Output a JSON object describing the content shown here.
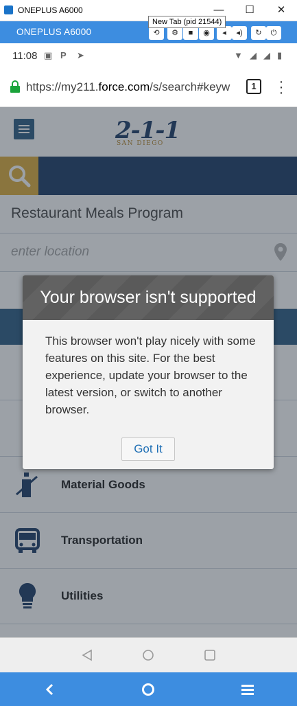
{
  "window": {
    "title": "ONEPLUS A6000",
    "tooltip": "New Tab (pid 21544)",
    "controls": [
      "—",
      "☐",
      "✕"
    ]
  },
  "device_bar": {
    "name": "ONEPLUS A6000"
  },
  "status_bar": {
    "time": "11:08"
  },
  "browser": {
    "url_prefix": "https://my211.",
    "url_domain": "force.com",
    "url_suffix": "/s/search#keyw",
    "tab_count": "1"
  },
  "page": {
    "logo": "2-1-1",
    "logo_sub": "SAN DIEGO",
    "keyword_value": "Restaurant Meals Program",
    "location_placeholder": "enter location",
    "categories": [
      {
        "label": "Material Goods",
        "icon": "bottle-icon"
      },
      {
        "label": "Transportation",
        "icon": "bus-icon"
      },
      {
        "label": "Utilities",
        "icon": "lightbulb-icon"
      }
    ]
  },
  "modal": {
    "title": "Your browser isn't supported",
    "body": "This browser won't play nicely with some features on this site. For the best experience, update your browser to the latest version, or switch to another browser.",
    "button": "Got It"
  },
  "colors": {
    "device_blue": "#3d8de0",
    "site_navy": "#2e4a72",
    "site_gold": "#e0b44a",
    "link_blue": "#1f6fb5"
  }
}
